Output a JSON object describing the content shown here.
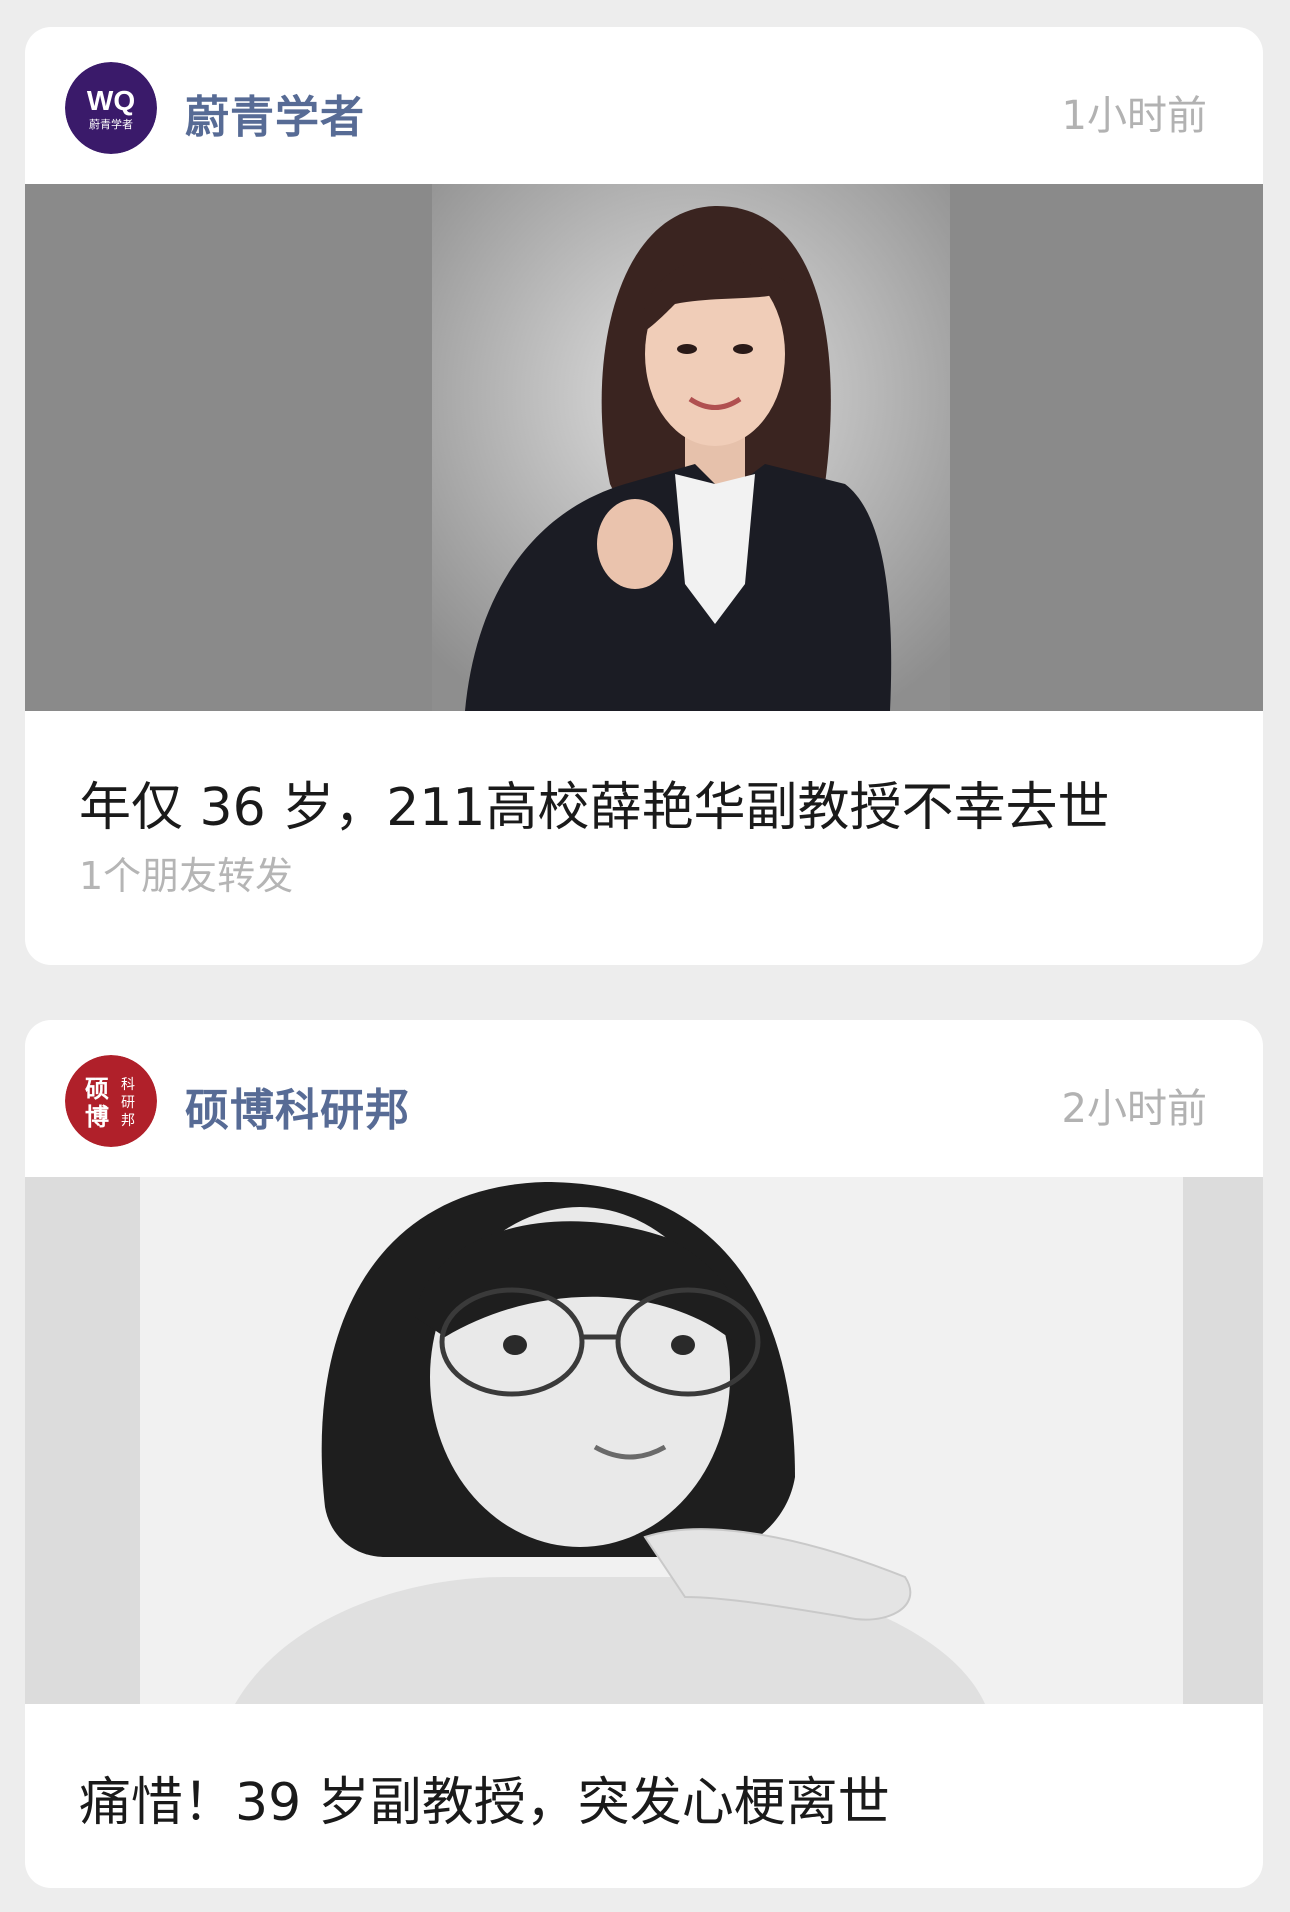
{
  "posts": [
    {
      "account": {
        "name": "蔚青学者",
        "avatar_text": "WQ",
        "avatar_sub": "蔚青学者"
      },
      "time": "1小时前",
      "title": "年仅 36 岁，211高校薛艳华副教授不幸去世",
      "shares": "1个朋友转发"
    },
    {
      "account": {
        "name": "硕博科研邦",
        "avatar_chars": [
          "硕",
          "博",
          "科",
          "研",
          "邦"
        ]
      },
      "time": "2小时前",
      "title": "痛惜！39 岁副教授，突发心梗离世"
    }
  ],
  "colors": {
    "background": "#ededed",
    "card": "#ffffff",
    "account_name": "#576b95",
    "time": "#b2b2b2",
    "title": "#1a1a1a",
    "avatar1": "#3a1a6a",
    "avatar2": "#b0202a"
  }
}
